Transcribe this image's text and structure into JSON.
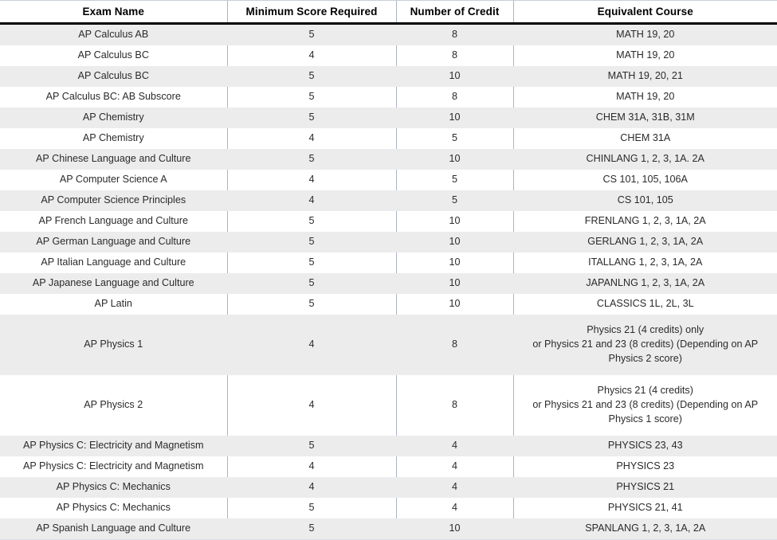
{
  "table": {
    "columns": [
      {
        "key": "exam_name",
        "label": "Exam Name"
      },
      {
        "key": "minimum_score",
        "label": "Minimum Score Required"
      },
      {
        "key": "number_of_credit",
        "label": "Number of Credit"
      },
      {
        "key": "equivalent_course",
        "label": "Equivalent Course"
      }
    ],
    "rows": [
      {
        "exam_name": "AP Calculus AB",
        "minimum_score": "5",
        "number_of_credit": "8",
        "equivalent_course": "MATH 19, 20"
      },
      {
        "exam_name": "AP Calculus BC",
        "minimum_score": "4",
        "number_of_credit": "8",
        "equivalent_course": "MATH 19, 20"
      },
      {
        "exam_name": "AP Calculus BC",
        "minimum_score": "5",
        "number_of_credit": "10",
        "equivalent_course": "MATH 19, 20, 21"
      },
      {
        "exam_name": "AP Calculus BC: AB Subscore",
        "minimum_score": "5",
        "number_of_credit": "8",
        "equivalent_course": "MATH 19, 20"
      },
      {
        "exam_name": "AP Chemistry",
        "minimum_score": "5",
        "number_of_credit": "10",
        "equivalent_course": "CHEM 31A, 31B, 31M"
      },
      {
        "exam_name": "AP Chemistry",
        "minimum_score": "4",
        "number_of_credit": "5",
        "equivalent_course": "CHEM 31A"
      },
      {
        "exam_name": "AP Chinese Language and Culture",
        "minimum_score": "5",
        "number_of_credit": "10",
        "equivalent_course": "CHINLANG 1, 2, 3, 1A. 2A"
      },
      {
        "exam_name": "AP Computer Science A",
        "minimum_score": "4",
        "number_of_credit": "5",
        "equivalent_course": "CS 101, 105, 106A"
      },
      {
        "exam_name": "AP Computer Science Principles",
        "minimum_score": "4",
        "number_of_credit": "5",
        "equivalent_course": "CS 101, 105"
      },
      {
        "exam_name": "AP French Language and Culture",
        "minimum_score": "5",
        "number_of_credit": "10",
        "equivalent_course": "FRENLANG 1, 2, 3, 1A, 2A"
      },
      {
        "exam_name": "AP German Language and Culture",
        "minimum_score": "5",
        "number_of_credit": "10",
        "equivalent_course": "GERLANG 1, 2, 3, 1A, 2A"
      },
      {
        "exam_name": "AP Italian Language and Culture",
        "minimum_score": "5",
        "number_of_credit": "10",
        "equivalent_course": "ITALLANG 1, 2, 3, 1A, 2A"
      },
      {
        "exam_name": "AP Japanese Language and Culture",
        "minimum_score": "5",
        "number_of_credit": "10",
        "equivalent_course": "JAPANLNG 1, 2, 3, 1A, 2A"
      },
      {
        "exam_name": "AP Latin",
        "minimum_score": "5",
        "number_of_credit": "10",
        "equivalent_course": "CLASSICS 1L, 2L, 3L"
      },
      {
        "exam_name": "AP Physics 1",
        "minimum_score": "4",
        "number_of_credit": "8",
        "equivalent_course": "Physics 21 (4 credits) only\nor Physics 21 and 23 (8 credits) (Depending on AP Physics 2 score)",
        "tall": true
      },
      {
        "exam_name": "AP Physics 2",
        "minimum_score": "4",
        "number_of_credit": "8",
        "equivalent_course": "Physics 21 (4 credits)\nor Physics 21 and 23 (8 credits) (Depending on AP Physics 1 score)",
        "tall": true
      },
      {
        "exam_name": "AP Physics C: Electricity and Magnetism",
        "minimum_score": "5",
        "number_of_credit": "4",
        "equivalent_course": "PHYSICS 23, 43"
      },
      {
        "exam_name": "AP Physics C: Electricity and Magnetism",
        "minimum_score": "4",
        "number_of_credit": "4",
        "equivalent_course": "PHYSICS 23"
      },
      {
        "exam_name": "AP Physics C: Mechanics",
        "minimum_score": "4",
        "number_of_credit": "4",
        "equivalent_course": "PHYSICS 21"
      },
      {
        "exam_name": "AP Physics C: Mechanics",
        "minimum_score": "5",
        "number_of_credit": "4",
        "equivalent_course": "PHYSICS 21, 41"
      },
      {
        "exam_name": "AP Spanish Language and Culture",
        "minimum_score": "5",
        "number_of_credit": "10",
        "equivalent_course": "SPANLANG 1, 2, 3, 1A, 2A"
      }
    ]
  },
  "colors": {
    "header_rule": "#000000",
    "stripe_shaded": "#ececec",
    "stripe_plain": "#ffffff",
    "divider": "#aab4c4",
    "text": "#2b2b2b"
  }
}
